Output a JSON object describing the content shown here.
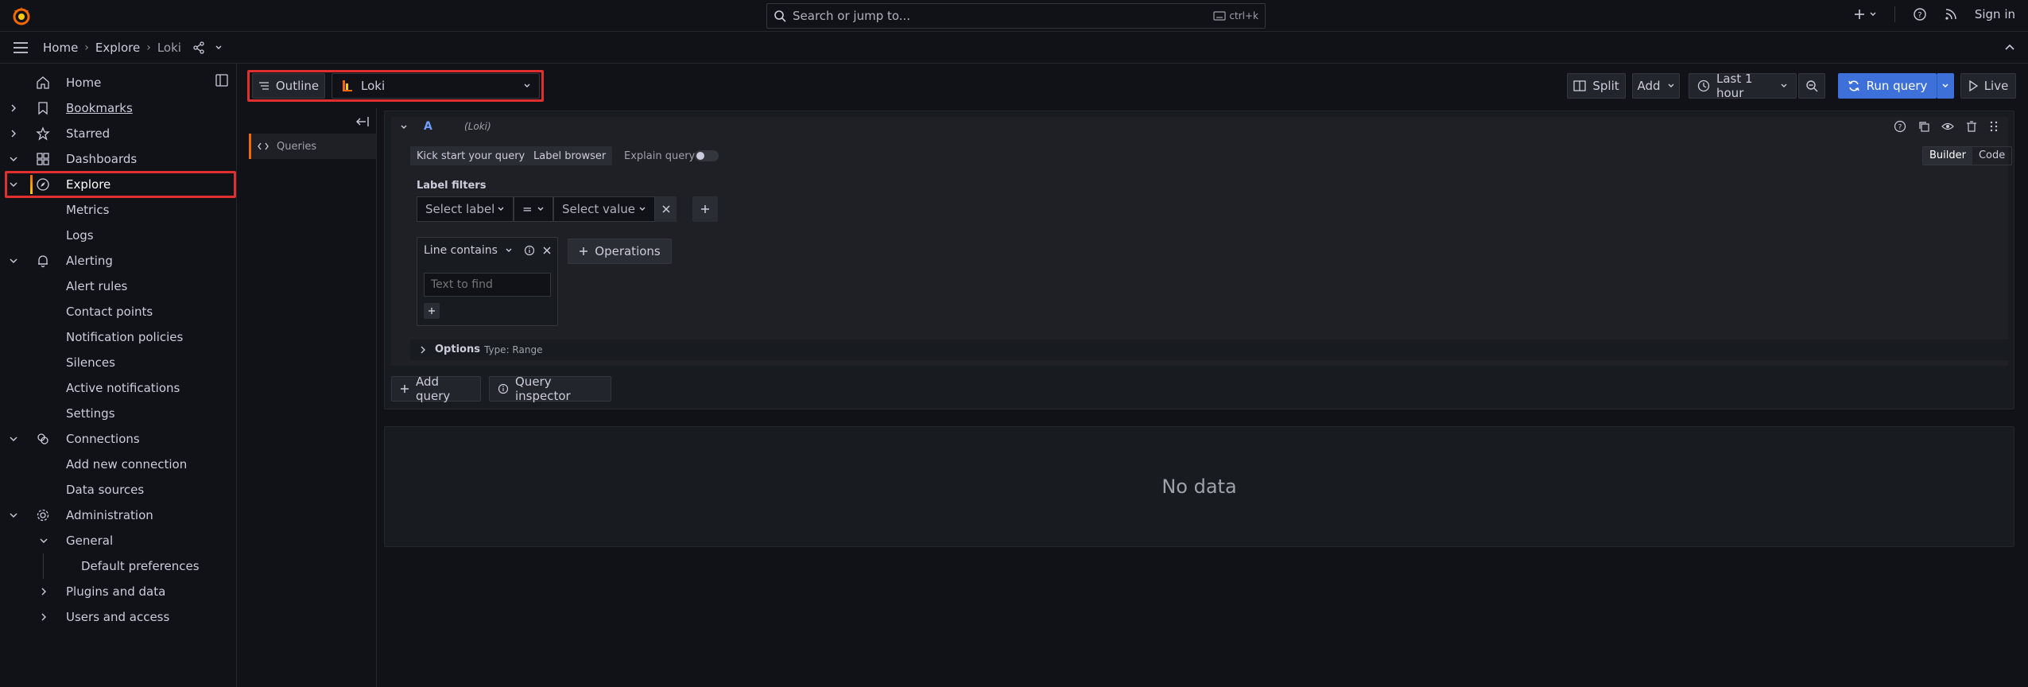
{
  "topbar": {
    "search_placeholder": "Search or jump to...",
    "search_shortcut": "ctrl+k",
    "sign_in": "Sign in"
  },
  "breadcrumb": [
    "Home",
    "Explore",
    "Loki"
  ],
  "sidebar": {
    "items": [
      {
        "label": "Home"
      },
      {
        "label": "Bookmarks"
      },
      {
        "label": "Starred"
      },
      {
        "label": "Dashboards"
      },
      {
        "label": "Explore"
      },
      {
        "label": "Metrics"
      },
      {
        "label": "Logs"
      },
      {
        "label": "Alerting"
      },
      {
        "label": "Alert rules"
      },
      {
        "label": "Contact points"
      },
      {
        "label": "Notification policies"
      },
      {
        "label": "Silences"
      },
      {
        "label": "Active notifications"
      },
      {
        "label": "Settings"
      },
      {
        "label": "Connections"
      },
      {
        "label": "Add new connection"
      },
      {
        "label": "Data sources"
      },
      {
        "label": "Administration"
      },
      {
        "label": "General"
      },
      {
        "label": "Default preferences"
      },
      {
        "label": "Plugins and data"
      },
      {
        "label": "Users and access"
      }
    ]
  },
  "toolbar": {
    "outline": "Outline",
    "datasource": "Loki",
    "split": "Split",
    "add": "Add",
    "time_range": "Last 1 hour",
    "run_query": "Run query",
    "live": "Live"
  },
  "outline_panel": {
    "queries": "Queries"
  },
  "query": {
    "ref_id": "A",
    "datasource_tag": "(Loki)",
    "kick_start": "Kick start your query",
    "label_browser": "Label browser",
    "explain_query": "Explain query",
    "mode_builder": "Builder",
    "mode_code": "Code",
    "label_filters": "Label filters",
    "select_label": "Select label",
    "operator": "=",
    "select_value": "Select value",
    "line_contains": "Line contains",
    "text_to_find_placeholder": "Text to find",
    "operations": "Operations",
    "options": "Options",
    "options_type": "Type: Range",
    "add_query": "Add query",
    "query_inspector": "Query inspector"
  },
  "results": {
    "no_data": "No data"
  },
  "colors": {
    "accent": "#3d71d9",
    "highlight": "#e02f2f",
    "grafana_orange": "#f46800"
  }
}
